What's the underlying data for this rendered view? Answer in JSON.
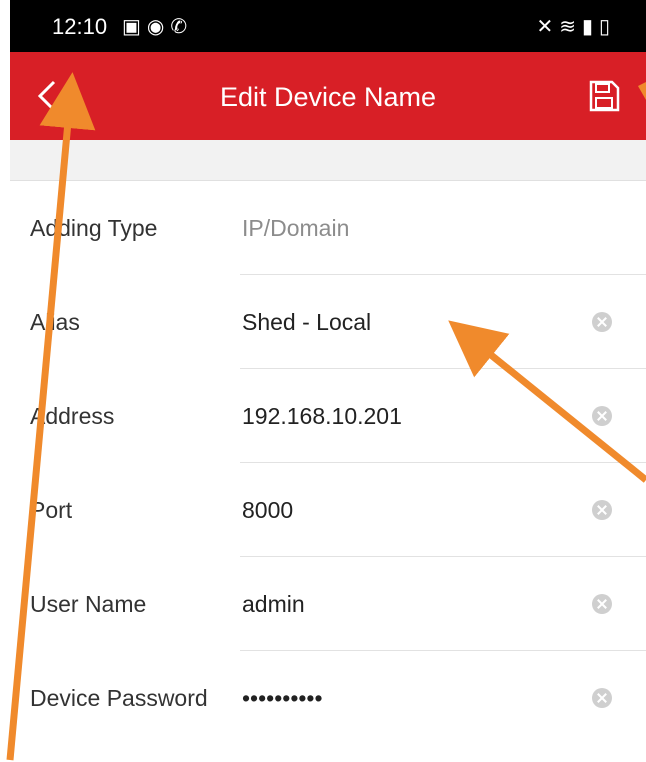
{
  "status_bar": {
    "time": "12:10",
    "left_icons": [
      "gallery-icon",
      "messenger-icon",
      "wifi-call-icon"
    ],
    "right_icons": [
      "mute-icon",
      "wifi-icon",
      "signal-icon",
      "battery-icon"
    ]
  },
  "app_bar": {
    "title": "Edit Device Name",
    "back_icon": "chevron-left-icon",
    "save_icon": "save-icon",
    "color": "#d81f26"
  },
  "form": {
    "rows": [
      {
        "label": "Adding Type",
        "value": "IP/Domain",
        "clearable": false
      },
      {
        "label": "Alias",
        "value": "Shed - Local",
        "clearable": true
      },
      {
        "label": "Address",
        "value": "192.168.10.201",
        "clearable": true
      },
      {
        "label": "Port",
        "value": "8000",
        "clearable": true
      },
      {
        "label": "User Name",
        "value": "admin",
        "clearable": true
      },
      {
        "label": "Device Password",
        "value": "••••••••••",
        "clearable": true
      }
    ]
  },
  "annotation_color": "#f08a2c"
}
